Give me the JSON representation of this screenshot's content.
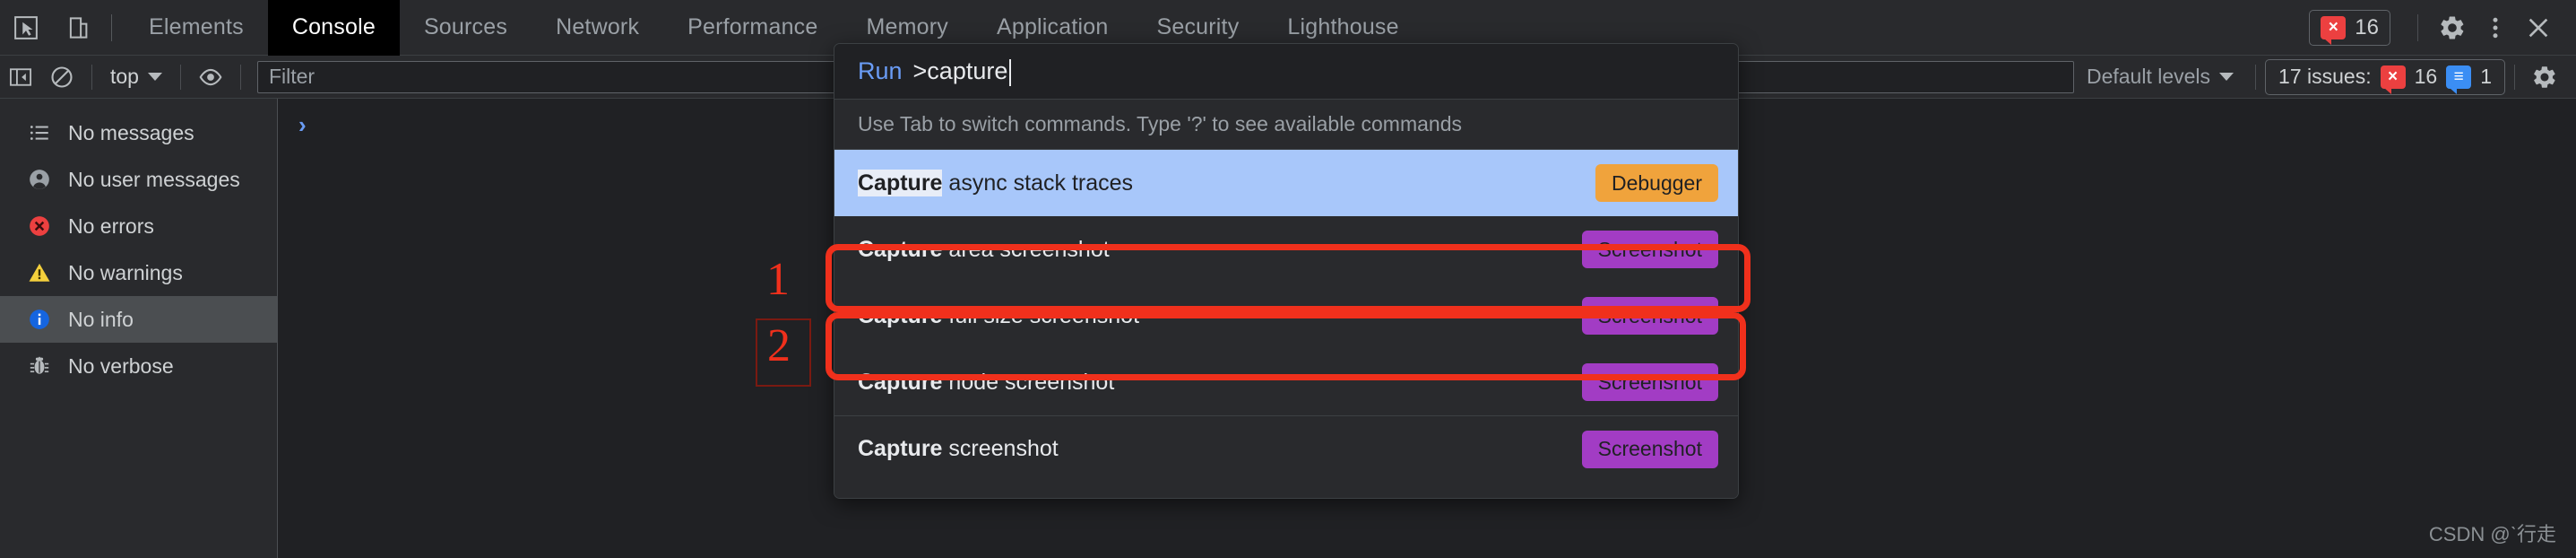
{
  "tabbar": {
    "icons": [
      {
        "name": "inspect-element-icon"
      },
      {
        "name": "device-toolbar-icon"
      }
    ],
    "tabs": [
      {
        "label": "Elements",
        "active": false
      },
      {
        "label": "Console",
        "active": true
      },
      {
        "label": "Sources",
        "active": false
      },
      {
        "label": "Network",
        "active": false
      },
      {
        "label": "Performance",
        "active": false
      },
      {
        "label": "Memory",
        "active": false
      },
      {
        "label": "Application",
        "active": false
      },
      {
        "label": "Security",
        "active": false
      },
      {
        "label": "Lighthouse",
        "active": false
      }
    ],
    "error_badge_glyph": "×",
    "error_count": "16",
    "settings_icon": "gear-icon",
    "more_icon": "kebab-menu-icon",
    "close_icon": "close-icon"
  },
  "console_toolbar": {
    "sidebar_toggle_icon": "sidebar-toggle-icon",
    "clear_console_icon": "clear-console-icon",
    "context": "top",
    "eye_icon": "live-expression-eye-icon",
    "filter_placeholder": "Filter",
    "levels_label": "Default levels",
    "issues_label": "17 issues:",
    "issues_error_glyph": "×",
    "issues_error_count": "16",
    "issues_info_glyph": "≡",
    "issues_info_count": "1",
    "settings_icon": "console-settings-gear-icon"
  },
  "sidebar": {
    "items": [
      {
        "label": "No messages",
        "icon": "list-icon"
      },
      {
        "label": "No user messages",
        "icon": "user-icon"
      },
      {
        "label": "No errors",
        "icon": "error-icon"
      },
      {
        "label": "No warnings",
        "icon": "warning-icon"
      },
      {
        "label": "No info",
        "icon": "info-icon",
        "selected": true
      },
      {
        "label": "No verbose",
        "icon": "bug-icon"
      }
    ]
  },
  "console": {
    "prompt_glyph": "›"
  },
  "palette": {
    "run_label": "Run",
    "query": ">capture",
    "hint": "Use Tab to switch commands. Type '?' to see available commands",
    "rows": [
      {
        "bold": "Capture",
        "rest": " async stack traces",
        "tag": "Debugger",
        "tag_color": "#f0a33c",
        "selected": true,
        "divided": false
      },
      {
        "bold": "Capture",
        "rest": " area screenshot",
        "tag": "Screenshot",
        "tag_color": "#a23cc4",
        "selected": false,
        "divided": false
      },
      {
        "bold": "Capture",
        "rest": " full size screenshot",
        "tag": "Screenshot",
        "tag_color": "#a23cc4",
        "selected": false,
        "divided": false
      },
      {
        "bold": "Capture",
        "rest": " node screenshot",
        "tag": "Screenshot",
        "tag_color": "#a23cc4",
        "selected": false,
        "divided": false
      },
      {
        "bold": "Capture",
        "rest": " screenshot",
        "tag": "Screenshot",
        "tag_color": "#a23cc4",
        "selected": false,
        "divided": true
      }
    ]
  },
  "annotations": {
    "marker_color": "#f0301c",
    "markers": [
      {
        "label": "1"
      },
      {
        "label": "2"
      }
    ]
  },
  "watermark": {
    "text": "CSDN @ˋ行走"
  },
  "colors": {
    "background": "#202124",
    "panel": "#292a2d",
    "selection_blue": "#a8c7fa",
    "accent_blue": "#6a9cf5",
    "error_red": "#ec4040",
    "annotation_red": "#f0301c",
    "tag_purple": "#a23cc4",
    "tag_orange": "#f0a33c"
  }
}
